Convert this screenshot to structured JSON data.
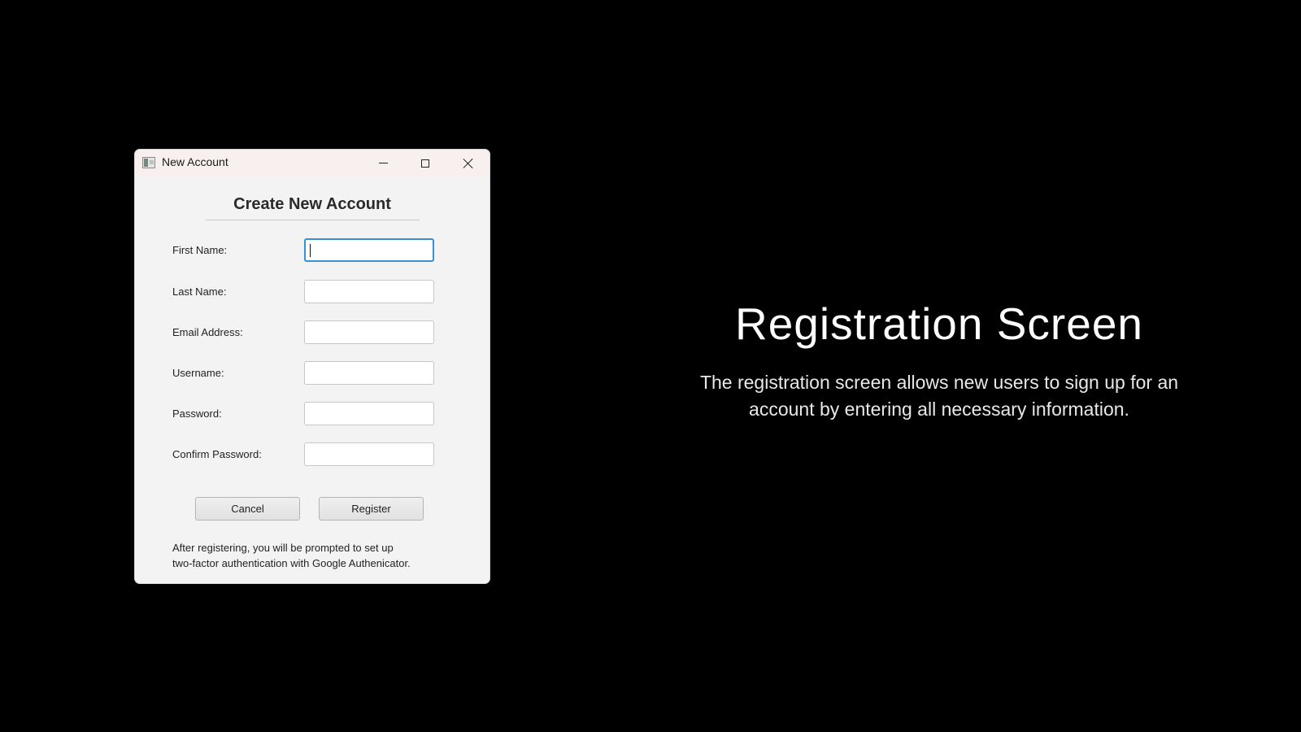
{
  "window": {
    "title": "New Account",
    "icon": "app-window-icon",
    "controls": {
      "minimize_icon": "minimize-icon",
      "maximize_icon": "maximize-icon",
      "close_icon": "close-icon"
    }
  },
  "form": {
    "heading": "Create New Account",
    "fields": [
      {
        "label": "First Name:",
        "value": "",
        "focused": true
      },
      {
        "label": "Last Name:",
        "value": ""
      },
      {
        "label": "Email Address:",
        "value": ""
      },
      {
        "label": "Username:",
        "value": ""
      },
      {
        "label": "Password:",
        "value": ""
      },
      {
        "label": "Confirm Password:",
        "value": ""
      }
    ],
    "buttons": {
      "cancel": "Cancel",
      "register": "Register"
    },
    "footnote": {
      "line1": "After registering, you will be prompted to set up",
      "line2": "two-factor authentication with Google Authenicator."
    }
  },
  "slide": {
    "title": "Registration Screen",
    "description_line1": "The registration screen allows new users to sign up for an",
    "description_line2": "account by entering all necessary information."
  },
  "colors": {
    "background": "#000000",
    "window_bg": "#f3f3f3",
    "titlebar_bg": "#f8efef",
    "focus_accent": "#3a8fd0"
  }
}
